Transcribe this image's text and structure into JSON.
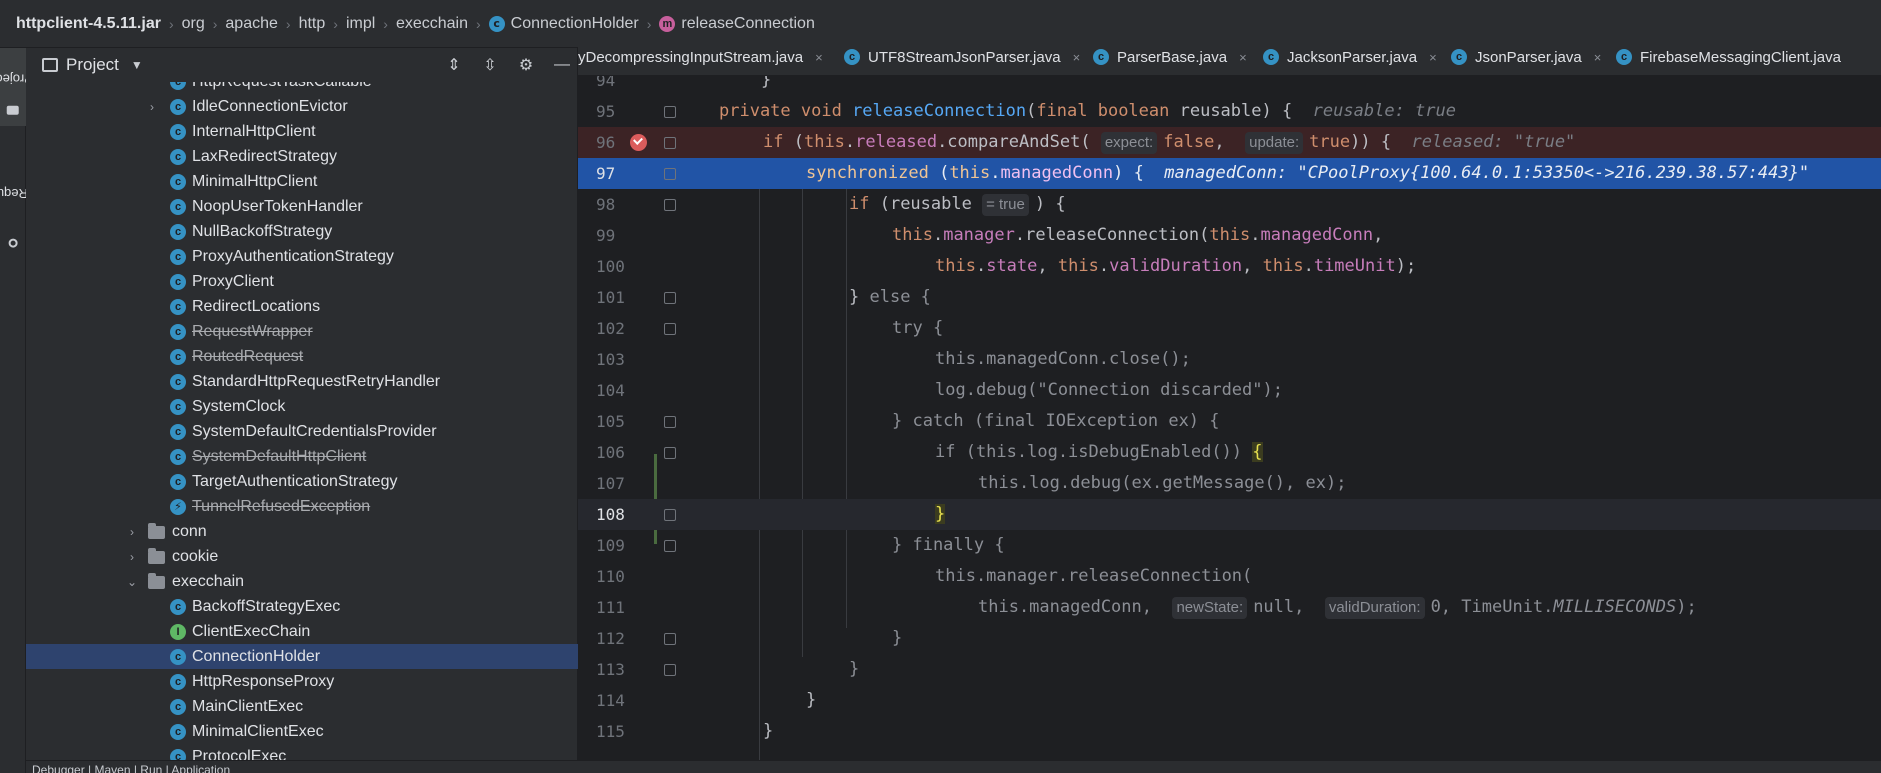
{
  "breadcrumb": {
    "items": [
      "httpclient-4.5.11.jar",
      "org",
      "apache",
      "http",
      "impl",
      "execchain",
      "ConnectionHolder",
      "releaseConnection"
    ],
    "separator": "›"
  },
  "toolstrip": {
    "project_label": "Project",
    "pull_requests_label": "Pull Requests"
  },
  "project_panel": {
    "title": "Project",
    "tree": [
      {
        "label": "HttpRequestTaskCallable",
        "kind": "class",
        "depth": 2,
        "partial": true
      },
      {
        "label": "IdleConnectionEvictor",
        "kind": "class",
        "depth": 2,
        "expandable": true
      },
      {
        "label": "InternalHttpClient",
        "kind": "class",
        "depth": 2
      },
      {
        "label": "LaxRedirectStrategy",
        "kind": "class",
        "depth": 2
      },
      {
        "label": "MinimalHttpClient",
        "kind": "class",
        "depth": 2
      },
      {
        "label": "NoopUserTokenHandler",
        "kind": "class",
        "depth": 2
      },
      {
        "label": "NullBackoffStrategy",
        "kind": "class",
        "depth": 2
      },
      {
        "label": "ProxyAuthenticationStrategy",
        "kind": "class",
        "depth": 2
      },
      {
        "label": "ProxyClient",
        "kind": "class",
        "depth": 2
      },
      {
        "label": "RedirectLocations",
        "kind": "class",
        "depth": 2
      },
      {
        "label": "RequestWrapper",
        "kind": "class",
        "depth": 2,
        "deprecated": true
      },
      {
        "label": "RoutedRequest",
        "kind": "class",
        "depth": 2,
        "deprecated": true
      },
      {
        "label": "StandardHttpRequestRetryHandler",
        "kind": "class",
        "depth": 2
      },
      {
        "label": "SystemClock",
        "kind": "class",
        "depth": 2
      },
      {
        "label": "SystemDefaultCredentialsProvider",
        "kind": "class",
        "depth": 2
      },
      {
        "label": "SystemDefaultHttpClient",
        "kind": "class",
        "depth": 2,
        "deprecated": true
      },
      {
        "label": "TargetAuthenticationStrategy",
        "kind": "class",
        "depth": 2
      },
      {
        "label": "TunnelRefusedException",
        "kind": "exception",
        "depth": 2,
        "deprecated": true
      },
      {
        "label": "conn",
        "kind": "folder",
        "depth": 1,
        "expanded": false
      },
      {
        "label": "cookie",
        "kind": "folder",
        "depth": 1,
        "expanded": false
      },
      {
        "label": "execchain",
        "kind": "folder",
        "depth": 1,
        "expanded": true
      },
      {
        "label": "BackoffStrategyExec",
        "kind": "class",
        "depth": 2
      },
      {
        "label": "ClientExecChain",
        "kind": "interface",
        "depth": 2
      },
      {
        "label": "ConnectionHolder",
        "kind": "class",
        "depth": 2,
        "selected": true
      },
      {
        "label": "HttpResponseProxy",
        "kind": "class",
        "depth": 2
      },
      {
        "label": "MainClientExec",
        "kind": "class",
        "depth": 2
      },
      {
        "label": "MinimalClientExec",
        "kind": "class",
        "depth": 2
      },
      {
        "label": "ProtocolExec",
        "kind": "class",
        "depth": 2
      }
    ]
  },
  "editor": {
    "tabs": [
      {
        "label": "yDecompressingInputStream.java",
        "icon": "none"
      },
      {
        "label": "UTF8StreamJsonParser.java",
        "icon": "class"
      },
      {
        "label": "ParserBase.java",
        "icon": "class"
      },
      {
        "label": "JacksonParser.java",
        "icon": "class"
      },
      {
        "label": "JsonParser.java",
        "icon": "class"
      },
      {
        "label": "FirebaseMessagingClient.java",
        "icon": "class"
      }
    ],
    "line_numbers": [
      "94",
      "95",
      "96",
      "97",
      "98",
      "99",
      "100",
      "101",
      "102",
      "103",
      "104",
      "105",
      "106",
      "107",
      "108",
      "109",
      "110",
      "111",
      "112",
      "113",
      "114",
      "115"
    ],
    "current_line": "108",
    "hints": {
      "l95": "reusable: true",
      "l96_expect": "expect:",
      "l96_update": "update:",
      "l96_released": "released: \"true\"",
      "l97_managed": "managedConn: \"CPoolProxy{100.64.0.1:53350<->216.239.38.57:443}\"",
      "l98_eq": "= true",
      "l111_newState": "newState:",
      "l111_validDuration": "validDuration:"
    }
  },
  "colors": {
    "keyword": "#cf8e6d",
    "method": "#56a8f5",
    "field": "#c77dbb",
    "string": "#6aab73",
    "exec_line": "#2154a6",
    "breakpoint": "#db5c5c",
    "selected_row": "#2e436e"
  },
  "statusbar": {
    "text": "Debugger  |  Maven  |  Run  |  Application"
  }
}
